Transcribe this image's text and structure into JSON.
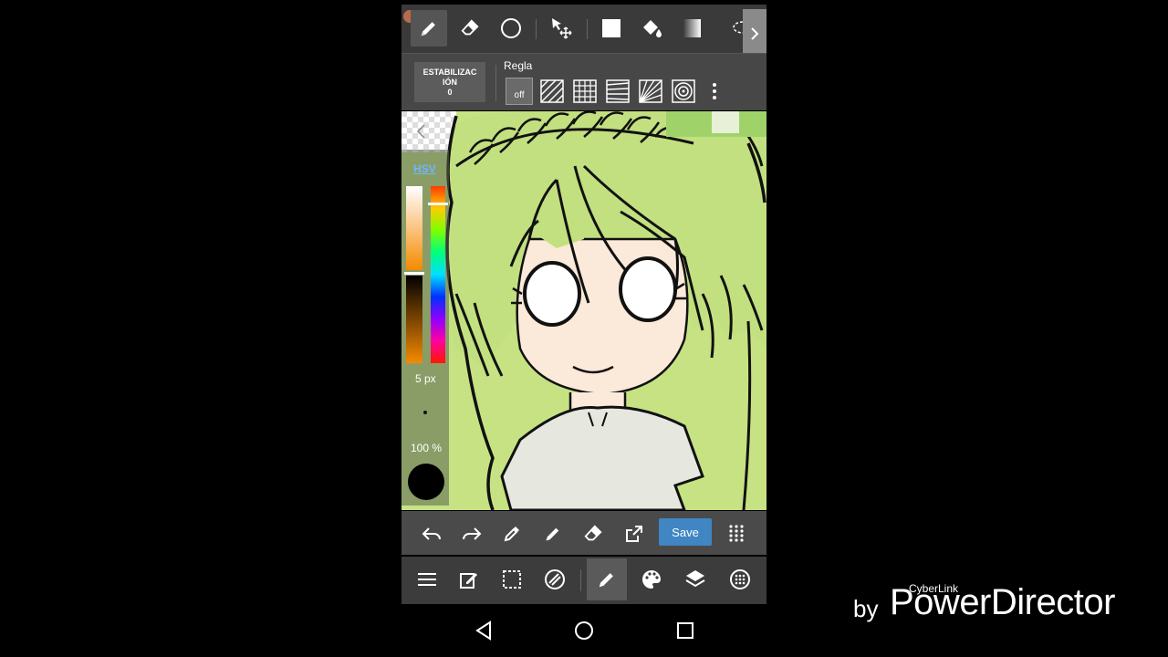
{
  "toolbar": {
    "tools": [
      {
        "icon": "pen-icon",
        "active": true
      },
      {
        "icon": "eraser-icon"
      },
      {
        "icon": "circle-icon"
      },
      {
        "icon": "move-icon"
      },
      {
        "icon": "fill-rect-icon"
      },
      {
        "icon": "bucket-icon"
      },
      {
        "icon": "gradient-icon"
      },
      {
        "icon": "lasso-icon"
      }
    ]
  },
  "stabilizer": {
    "label_line1": "ESTABILIZAC",
    "label_line2": "IÓN",
    "value": "0"
  },
  "ruler": {
    "label": "Regla",
    "off_label": "off"
  },
  "side_panel": {
    "color_mode": "HSV",
    "brush_size": "5 px",
    "opacity": "100 %"
  },
  "actions": {
    "save_label": "Save"
  },
  "watermark": {
    "by": "by",
    "brand": "PowerDirector",
    "company": "CyberLink"
  },
  "colors": {
    "accent": "#3f86c2",
    "canvas": "#c6e283",
    "hair": "#c2e07f",
    "skin": "#fbe9d9",
    "shirt": "#e6e8e0"
  }
}
